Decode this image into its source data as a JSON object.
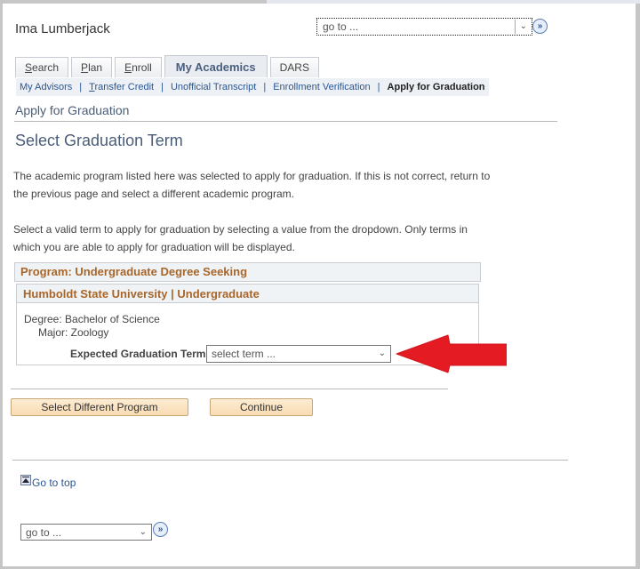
{
  "header": {
    "user_name": "Ima Lumberjack",
    "goto_select": {
      "value": "go to ...",
      "go_icon": "double-chevron-right-icon"
    }
  },
  "tabs": [
    {
      "label": "Search",
      "accesskey": "S",
      "rest": "earch",
      "active": false
    },
    {
      "label": "Plan",
      "accesskey": "P",
      "rest": "lan",
      "active": false
    },
    {
      "label": "Enroll",
      "accesskey": "E",
      "rest": "nroll",
      "active": false
    },
    {
      "label": "My Academics",
      "active": true
    },
    {
      "label": "DARS",
      "active": false
    }
  ],
  "subnav": {
    "items": [
      {
        "label": "My Advisors"
      },
      {
        "label": "Transfer Credit",
        "accesskey": "T",
        "rest": "ransfer Credit"
      },
      {
        "label": "Unofficial Transcript"
      },
      {
        "label": "Enrollment Verification"
      },
      {
        "label": "Apply for Graduation",
        "current": true
      }
    ],
    "separator": "|"
  },
  "page": {
    "subtitle": "Apply for Graduation",
    "title": "Select Graduation Term",
    "paragraph1": "The academic program listed here was selected to apply for graduation. If this is not correct, return to the previous page and select a different academic program.",
    "paragraph2": "Select a valid term to apply for graduation by selecting a value from the dropdown. Only terms in which you are able to apply for graduation will be displayed."
  },
  "program": {
    "header": "Program: Undergraduate Degree Seeking",
    "institution": "Humboldt State University | Undergraduate",
    "degree": "Degree: Bachelor of Science",
    "major": "Major: Zoology",
    "term_label": "Expected Graduation Term",
    "term_select": {
      "value": "select term ..."
    }
  },
  "annotation": {
    "type": "red-arrow",
    "color": "#e41b23",
    "points_to": "term_select"
  },
  "buttons": {
    "select_different": "Select Different Program",
    "continue": "Continue"
  },
  "footer": {
    "go_to_top": "Go to top",
    "goto_select": {
      "value": "go to ..."
    }
  }
}
